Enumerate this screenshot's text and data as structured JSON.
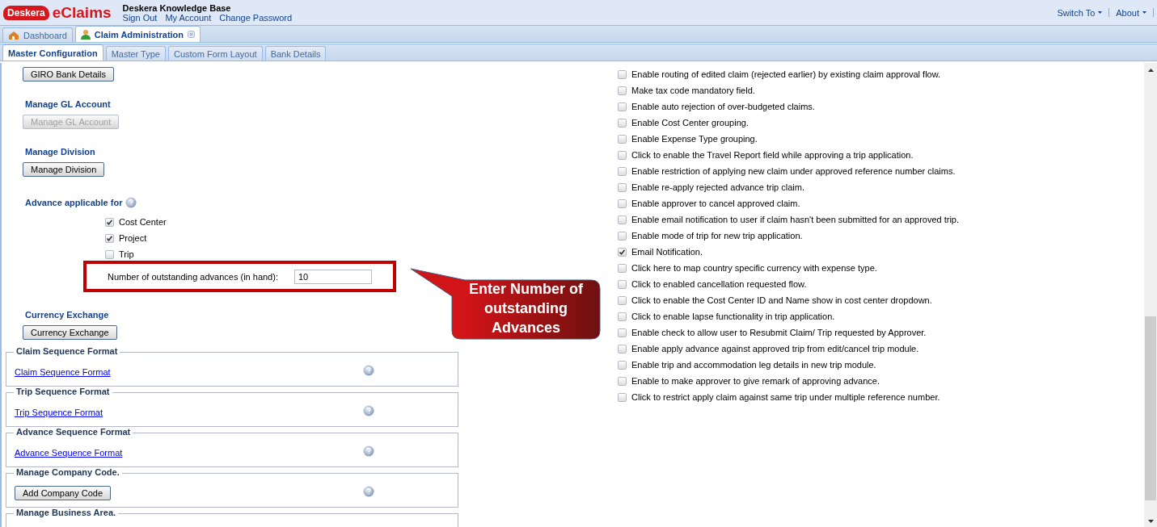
{
  "header": {
    "logo_brand": "Deskera",
    "logo_product": "eClaims",
    "company": "Deskera Knowledge Base",
    "user_links": [
      "Sign Out",
      "My Account",
      "Change Password"
    ],
    "menus": [
      "Switch To",
      "About"
    ]
  },
  "main_tabs": [
    {
      "label": "Dashboard",
      "selected": false,
      "closable": false
    },
    {
      "label": "Claim Administration",
      "selected": true,
      "closable": true
    }
  ],
  "sub_tabs": [
    {
      "label": "Master Configuration",
      "selected": true
    },
    {
      "label": "Master Type",
      "selected": false
    },
    {
      "label": "Custom Form Layout",
      "selected": false
    },
    {
      "label": "Bank Details",
      "selected": false
    }
  ],
  "left_sections": [
    {
      "kind": "button",
      "button": "GIRO Bank Details",
      "disabled": false
    },
    {
      "kind": "heading_button",
      "heading": "Manage GL Account",
      "button": "Manage GL Account",
      "disabled": true
    },
    {
      "kind": "heading_button",
      "heading": "Manage Division",
      "button": "Manage Division",
      "disabled": false
    },
    {
      "kind": "advance",
      "heading": "Advance applicable for",
      "options": [
        {
          "label": "Cost Center",
          "checked": true
        },
        {
          "label": "Project",
          "checked": true
        },
        {
          "label": "Trip",
          "checked": false
        }
      ],
      "field_label": "Number of outstanding advances (in hand):",
      "field_value": "10"
    },
    {
      "kind": "heading_button",
      "heading": "Currency Exchange",
      "button": "Currency Exchange",
      "disabled": false
    },
    {
      "kind": "fieldset_link",
      "legend": "Claim Sequence Format",
      "link": "Claim Sequence Format"
    },
    {
      "kind": "fieldset_link",
      "legend": "Trip Sequence Format",
      "link": "Trip Sequence Format"
    },
    {
      "kind": "fieldset_link",
      "legend": "Advance Sequence Format",
      "link": "Advance Sequence Format"
    },
    {
      "kind": "fieldset_button",
      "legend": "Manage Company Code.",
      "button": "Add Company Code"
    },
    {
      "kind": "fieldset_cut",
      "legend": "Manage Business Area."
    }
  ],
  "options": [
    {
      "label": "Enable routing of edited claim (rejected earlier) by existing claim approval flow.",
      "checked": false
    },
    {
      "label": "Make tax code mandatory field.",
      "checked": false
    },
    {
      "label": "Enable auto rejection of over-budgeted claims.",
      "checked": false
    },
    {
      "label": "Enable Cost Center grouping.",
      "checked": false
    },
    {
      "label": "Enable Expense Type grouping.",
      "checked": false
    },
    {
      "label": "Click to enable the Travel Report field while approving a trip application.",
      "checked": false
    },
    {
      "label": "Enable restriction of applying new claim under approved reference number claims.",
      "checked": false
    },
    {
      "label": "Enable re-apply rejected advance trip claim.",
      "checked": false
    },
    {
      "label": "Enable approver to cancel approved claim.",
      "checked": false
    },
    {
      "label": "Enable email notification to user if claim hasn't been submitted for an approved trip.",
      "checked": false
    },
    {
      "label": "Enable mode of trip for new trip application.",
      "checked": false
    },
    {
      "label": "Email Notification.",
      "checked": true
    },
    {
      "label": "Click here to map country specific currency with expense type.",
      "checked": false
    },
    {
      "label": "Click to enabled cancellation requested flow.",
      "checked": false
    },
    {
      "label": "Click to enable the Cost Center ID and Name show in cost center dropdown.",
      "checked": false
    },
    {
      "label": "Click to enable lapse functionality in trip application.",
      "checked": false
    },
    {
      "label": "Enable check to allow user to Resubmit Claim/ Trip requested by Approver.",
      "checked": false
    },
    {
      "label": "Enable apply advance against approved trip from edit/cancel trip module.",
      "checked": false
    },
    {
      "label": "Enable trip and accommodation leg details in new trip module.",
      "checked": false
    },
    {
      "label": "Enable to make approver to give remark of approving advance.",
      "checked": false
    },
    {
      "label": "Click to restrict apply claim against same trip under multiple reference number.",
      "checked": false
    }
  ],
  "callout": {
    "text": "Enter Number of outstanding Advances"
  }
}
